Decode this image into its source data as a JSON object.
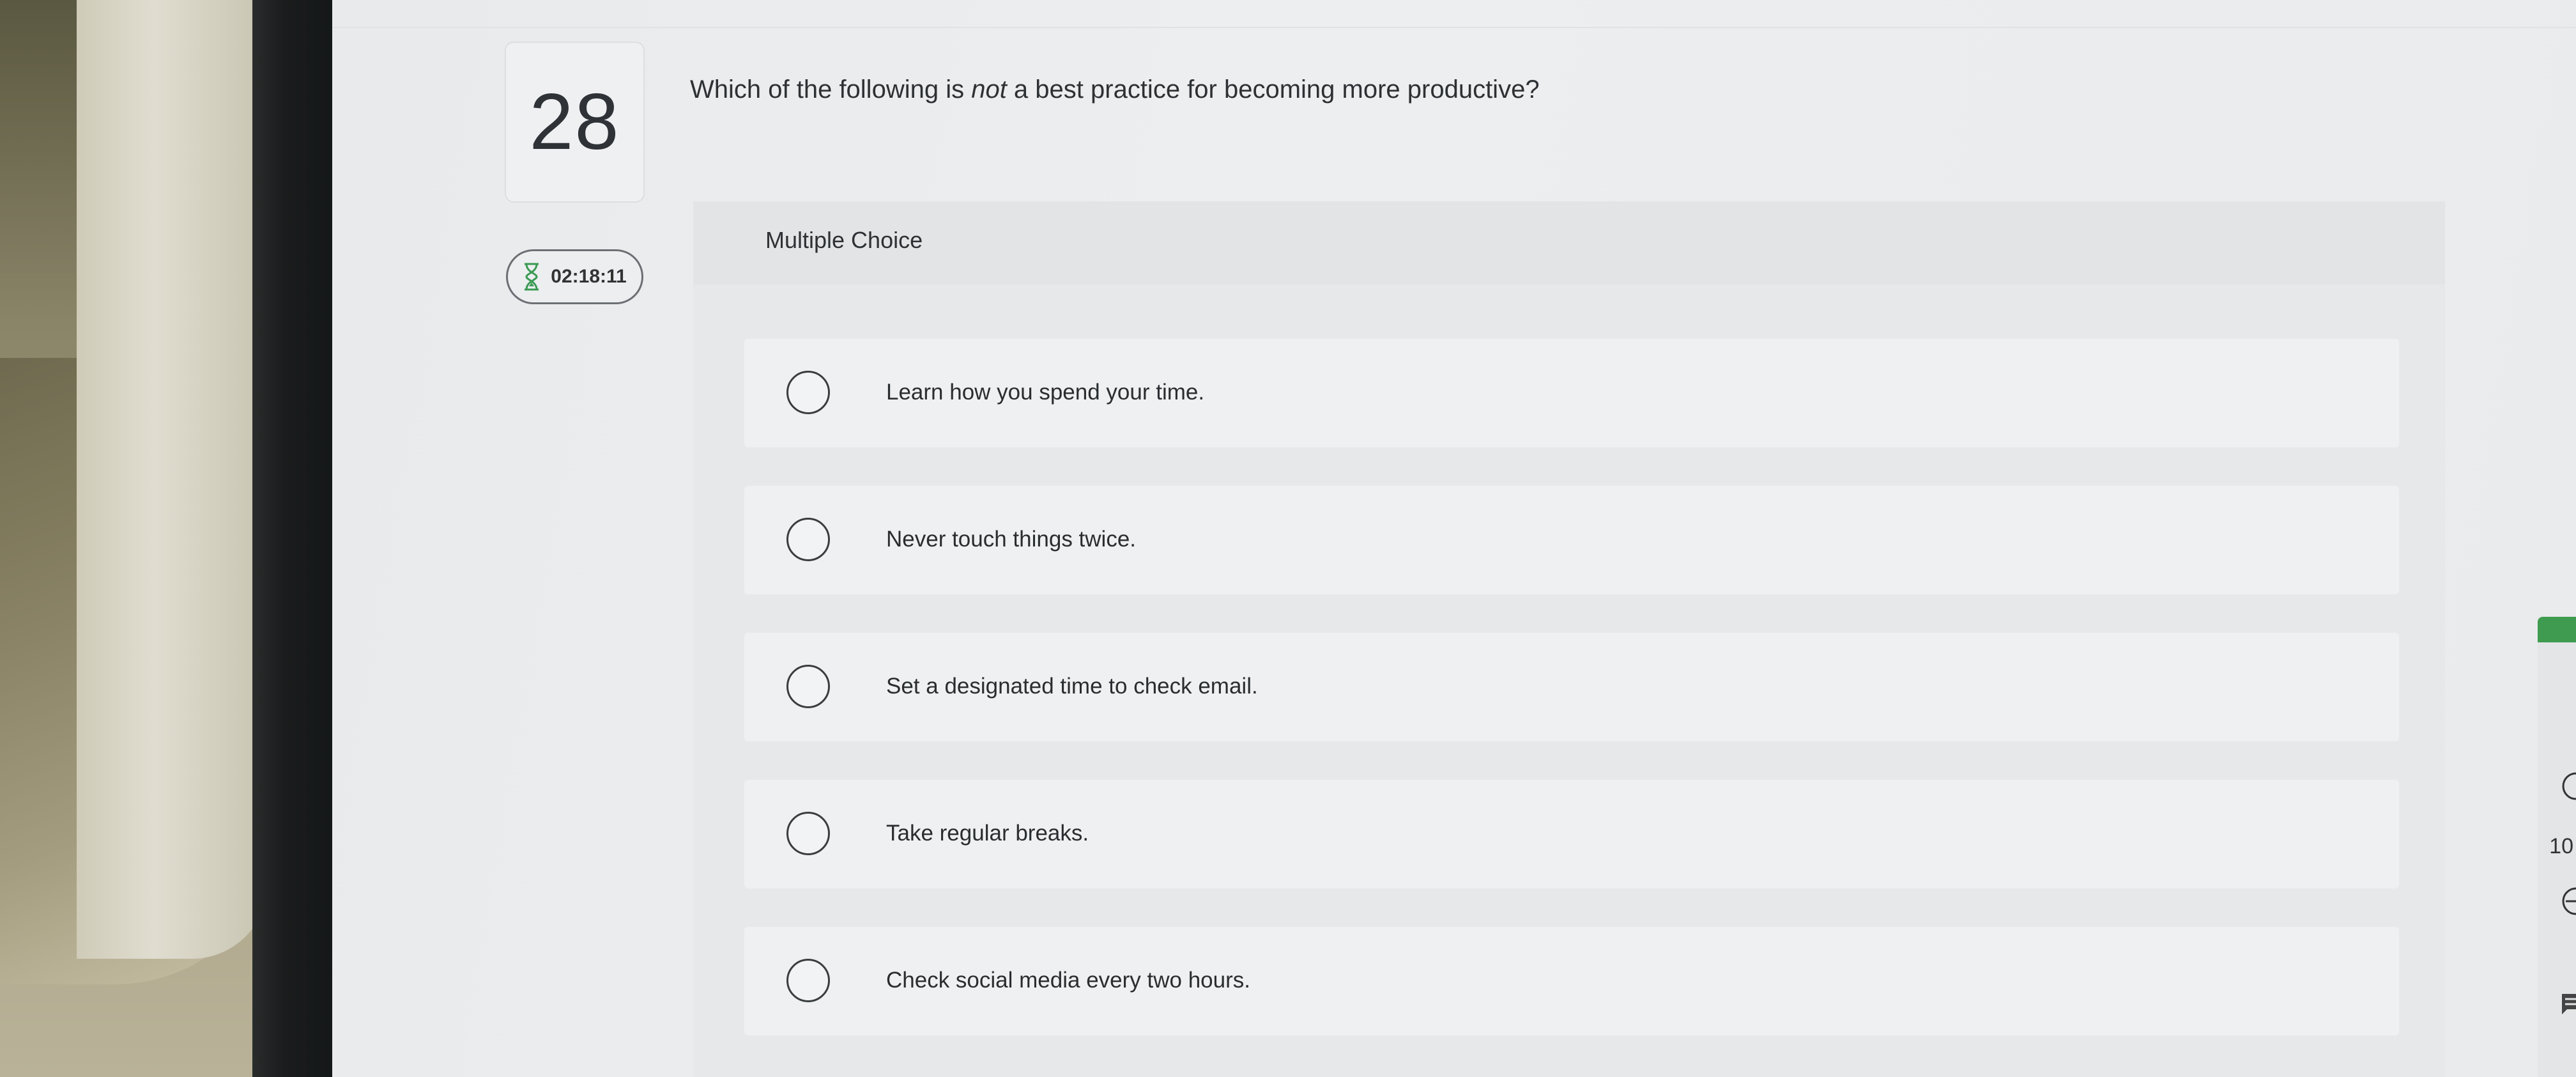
{
  "question": {
    "number": "28",
    "text_before": "Which of the following is ",
    "text_emphasis": "not",
    "text_after": " a best practice for becoming more productive?",
    "timer": "02:18:11"
  },
  "answer_panel": {
    "type_label": "Multiple Choice",
    "options": [
      {
        "label": "Learn how you spend your time."
      },
      {
        "label": "Never touch things twice."
      },
      {
        "label": "Set a designated time to check email."
      },
      {
        "label": "Take regular breaks."
      },
      {
        "label": "Check social media every two hours."
      }
    ]
  },
  "right_toolbar": {
    "zoom_fragment": "10"
  },
  "icons": {
    "timer_icon": "hourglass-icon",
    "zoom_in": "zoom-in-icon",
    "zoom_out": "zoom-out-icon",
    "feedback": "comment-icon"
  },
  "colors": {
    "accent_green": "#3e9b4f",
    "text_dark": "#2e3134",
    "radio_border": "#3a3d40"
  }
}
